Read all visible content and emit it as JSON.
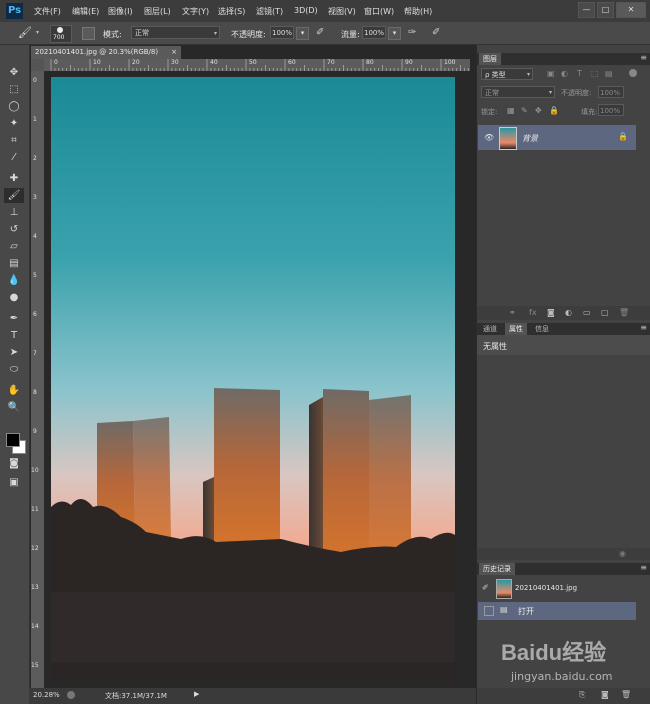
{
  "app": {
    "logo": "Ps"
  },
  "menu": [
    "文件(F)",
    "编辑(E)",
    "图像(I)",
    "图层(L)",
    "文字(Y)",
    "选择(S)",
    "滤镜(T)",
    "3D(D)",
    "视图(V)",
    "窗口(W)",
    "帮助(H)"
  ],
  "window_controls": {
    "minimize": "—",
    "restore": "□",
    "close": "✕"
  },
  "options": {
    "brush_size": "700",
    "mode_label": "模式:",
    "mode_value": "正常",
    "opacity_label": "不透明度:",
    "opacity_value": "100%",
    "flow_label": "流量:",
    "flow_value": "100%"
  },
  "document": {
    "tab_title": "20210401401.jpg @ 20.3%(RGB/8)",
    "tab_close": "×",
    "zoom": "20.28%",
    "doc_size": "文档:37.1M/37.1M",
    "ruler_top": [
      "0",
      "10",
      "20",
      "30",
      "40",
      "50",
      "60",
      "70",
      "80",
      "90",
      "100"
    ],
    "ruler_left": [
      "0",
      "1",
      "2",
      "3",
      "4",
      "5",
      "6",
      "7",
      "8",
      "9",
      "10",
      "11",
      "12",
      "13",
      "14",
      "15"
    ]
  },
  "layers_panel": {
    "tab": "图层",
    "filter_label": "ρ 类型",
    "blend_mode": "正常",
    "opacity_label": "不透明度:",
    "opacity_value": "100%",
    "lock_label": "锁定:",
    "fill_label": "填充:",
    "fill_value": "100%",
    "layer_name": "背景"
  },
  "properties_panel": {
    "tabs": [
      "通道",
      "属性",
      "信息"
    ],
    "content": "无属性"
  },
  "history_panel": {
    "tab": "历史记录",
    "snapshot": "20210401401.jpg",
    "step": "打开"
  },
  "watermark": {
    "brand": "Baidu经验",
    "url": "jingyan.baidu.com"
  }
}
